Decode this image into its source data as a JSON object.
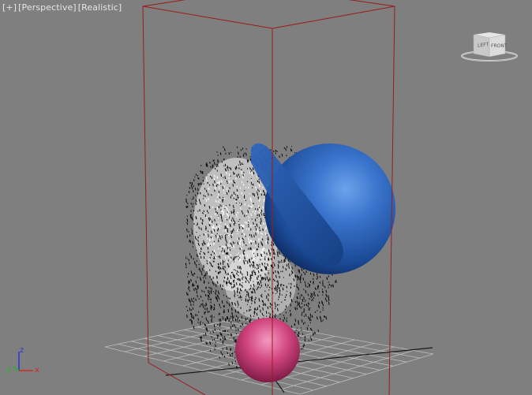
{
  "viewport": {
    "label": {
      "plus": "[+]",
      "view": "[Perspective]",
      "shading": "[Realistic]"
    }
  },
  "viewcube": {
    "front_face": "LEFT",
    "side_face": "FRONT"
  },
  "axis_gizmo": {
    "x": "x",
    "y": "y",
    "z": "z",
    "colors": {
      "x": "#d02a2a",
      "y": "#2bb12b",
      "z": "#2a3ad0"
    }
  },
  "scene_colors": {
    "background": "#7f7f7f",
    "bounding_box": "#9b1b1b",
    "grid": "#bdbdbd",
    "large_sphere": "#1f54a8",
    "small_sphere": "#c83a72",
    "particles": "#000000"
  }
}
